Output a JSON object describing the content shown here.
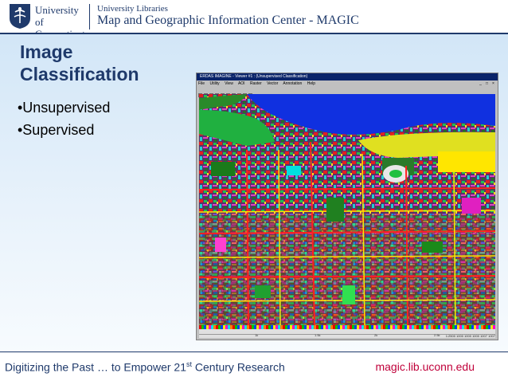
{
  "header": {
    "logo_line1": "University of",
    "logo_line2": "Connecticut",
    "sublabel": "University Libraries",
    "title": "Map and Geographic Information Center - MAGIC"
  },
  "slide": {
    "title": "Image Classification",
    "bullets": [
      "•Unsupervised",
      "•Supervised"
    ]
  },
  "screenshot": {
    "window_title": "ERDAS IMAGINE - Viewer #1 : (Unsupervised Classification)",
    "menu": [
      "File",
      "Utility",
      "View",
      "AOI",
      "Raster",
      "Vector",
      "Annotation",
      "Help"
    ],
    "ruler_labels": [
      "1k",
      "1.5k",
      "2k",
      "2.5k"
    ],
    "status_text": "1:2500  1000  1000  1000  1007  1007",
    "icons": [
      "minimize-icon",
      "maximize-icon",
      "close-icon"
    ]
  },
  "footer": {
    "left_prefix": "Digitizing the Past … to Empower 21",
    "left_sup": "st",
    "left_suffix": " Century Research",
    "right": "magic.lib.uconn.edu"
  },
  "colors": {
    "brand_navy": "#1f3a6b",
    "link_red": "#c0003a",
    "river_blue": "#1030e0"
  }
}
